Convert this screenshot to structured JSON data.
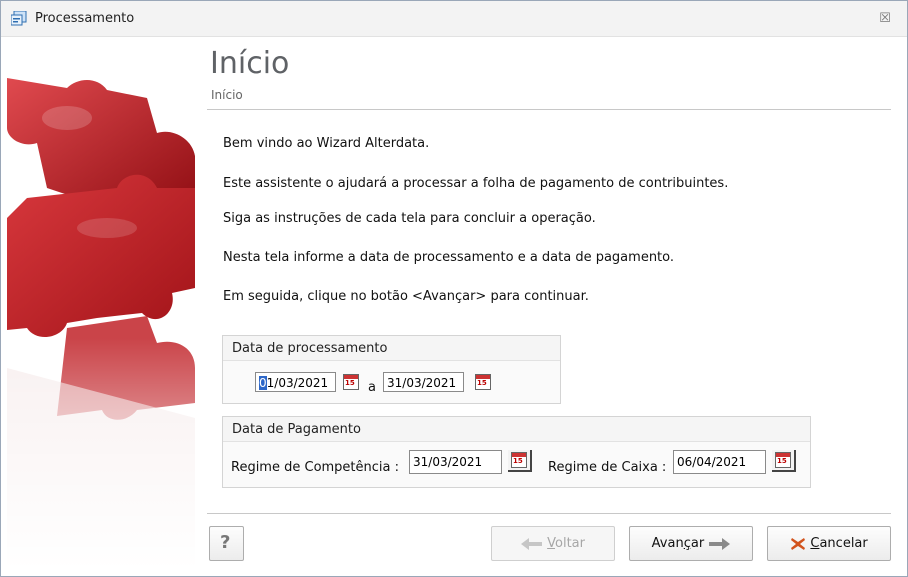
{
  "window": {
    "title": "Processamento",
    "close_glyph": "☒"
  },
  "header": {
    "title": "Início",
    "subtitle": "Início"
  },
  "paragraphs": [
    "Bem vindo ao Wizard Alterdata.",
    "Este assistente o ajudará a processar a folha de pagamento de contribuintes.",
    "Siga as instruções de cada tela para concluir a operação.",
    "Nesta tela informe a data de processamento e a data de pagamento.",
    "Em seguida, clique no botão <Avançar> para continuar."
  ],
  "processing": {
    "title": "Data de processamento",
    "start_first_char": "0",
    "start_rest": "1/03/2021",
    "separator": "a",
    "end": "31/03/2021"
  },
  "payment": {
    "title": "Data de Pagamento",
    "competencia_label": "Regime de Competência :",
    "competencia_value": "31/03/2021",
    "caixa_label": "Regime de Caixa :",
    "caixa_value": "06/04/2021"
  },
  "calendar_icon_text": "15",
  "buttons": {
    "help": "?",
    "back_prefix": "",
    "back_ul": "V",
    "back_rest": "oltar",
    "next_prefix": "Avan",
    "next_ul": "ç",
    "next_rest": "ar",
    "cancel_ul": "C",
    "cancel_rest": "ancelar"
  },
  "colors": {
    "accent_red": "#c7262c",
    "puzzle_red": "#b4151b",
    "arrow_gray": "#8a8a8a"
  }
}
